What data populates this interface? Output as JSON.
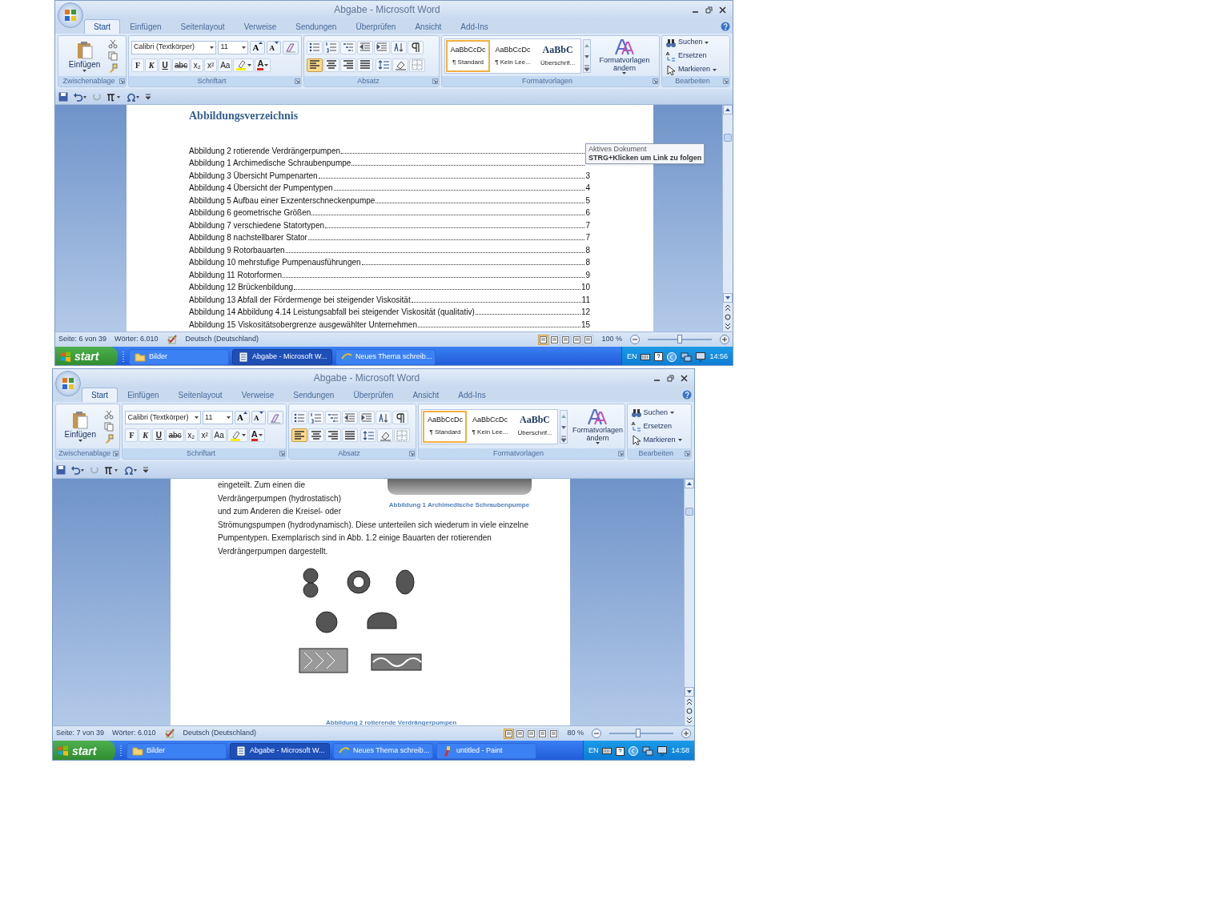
{
  "windows": [
    {
      "title": "Abgabe - Microsoft Word",
      "tabs": [
        {
          "label": "Start",
          "selected": true
        },
        {
          "label": "Einfügen",
          "selected": false
        },
        {
          "label": "Seitenlayout",
          "selected": false
        },
        {
          "label": "Verweise",
          "selected": false
        },
        {
          "label": "Sendungen",
          "selected": false
        },
        {
          "label": "Überprüfen",
          "selected": false
        },
        {
          "label": "Ansicht",
          "selected": false
        },
        {
          "label": "Add-Ins",
          "selected": false
        }
      ],
      "ribbon": {
        "clipboard": {
          "paste": "Einfügen",
          "label": "Zwischenablage"
        },
        "font": {
          "name": "Calibri (Textkörper)",
          "size": "11",
          "size_buttons": [
            "A",
            "A"
          ],
          "format_buttons": [
            "F",
            "K",
            "U",
            "abc",
            "x₂",
            "x²",
            "Aa"
          ],
          "color_button": "A",
          "label": "Schriftart"
        },
        "paragraph": {
          "alignment_buttons": [
            {
              "selected": true
            },
            {
              "selected": false
            },
            {
              "selected": false
            },
            {
              "selected": false
            }
          ],
          "label": "Absatz"
        },
        "styles": {
          "items": [
            {
              "sample": "AaBbCcDc",
              "name": "¶ Standard",
              "selected": true,
              "kind": "normal"
            },
            {
              "sample": "AaBbCcDc",
              "name": "¶ Kein Lee...",
              "selected": false,
              "kind": "normal"
            },
            {
              "sample": "AaBbC",
              "name": "Überschrif...",
              "selected": false,
              "kind": "heading"
            }
          ],
          "change_button": "Formatvorlagen ändern",
          "label": "Formatvorlagen"
        },
        "editing": {
          "buttons": [
            "Suchen",
            "Ersetzen",
            "Markieren"
          ],
          "label": "Bearbeiten"
        }
      },
      "document": {
        "kind": "toc",
        "heading": "Abbildungsverzeichnis",
        "entries": [
          {
            "text": "Abbildung 2 rotierende Verdrängerpumpen"
          },
          {
            "text": "Abbildung 1 Archimedische Schraubenpumpe"
          },
          {
            "text": "Abbildung 3 Übersicht Pumpenarten",
            "page": "3"
          },
          {
            "text": "Abbildung 4 Übersicht der Pumpentypen",
            "page": "4"
          },
          {
            "text": "Abbildung 5 Aufbau einer Exzenterschneckenpumpe",
            "page": "5"
          },
          {
            "text": "Abbildung 6 geometrische Größen",
            "page": "6"
          },
          {
            "text": "Abbildung 7 verschiedene Statortypen",
            "page": "7"
          },
          {
            "text": "Abbildung 8 nachstellbarer Stator",
            "page": "7"
          },
          {
            "text": "Abbildung 9 Rotorbauarten",
            "page": "8"
          },
          {
            "text": "Abbildung 10 mehrstufige Pumpenausführungen",
            "page": "8"
          },
          {
            "text": "Abbildung 11 Rotorformen",
            "page": "9"
          },
          {
            "text": "Abbildung 12 Brückenbildung",
            "page": "10"
          },
          {
            "text": "Abbildung 13 Abfall der Fördermenge bei steigender Viskosität",
            "page": "11"
          },
          {
            "text": "Abbildung 14 Abbildung 4.14 Leistungsabfall bei steigender Viskosität (qualitativ)",
            "page": "12"
          },
          {
            "text": "Abbildung 15 Viskositätsobergrenze ausgewählter Unternehmen",
            "page": "15"
          }
        ],
        "tooltip": {
          "title": "Aktives Dokument",
          "hint": "STRG+Klicken um Link zu folgen"
        }
      },
      "status_bar": {
        "page": "Seite: 6 von 39",
        "words": "Wörter: 6.010",
        "language": "Deutsch (Deutschland)",
        "views": [
          {
            "selected": true
          },
          {
            "selected": false
          },
          {
            "selected": false
          },
          {
            "selected": false
          },
          {
            "selected": false
          }
        ],
        "zoom": "100 %",
        "zoom_slider": {
          "level": 0.5
        }
      },
      "taskbar": {
        "start": "start",
        "items": [
          {
            "label": "Bilder",
            "kind": "folder",
            "selected": false
          },
          {
            "label": "Abgabe - Microsoft W...",
            "kind": "word",
            "selected": true
          },
          {
            "label": "Neues Thema schreib...",
            "kind": "browser",
            "selected": false
          }
        ],
        "language": "EN",
        "clock": "14:56"
      }
    },
    {
      "title": "Abgabe - Microsoft Word",
      "tabs": [
        {
          "label": "Start",
          "selected": true
        },
        {
          "label": "Einfügen",
          "selected": false
        },
        {
          "label": "Seitenlayout",
          "selected": false
        },
        {
          "label": "Verweise",
          "selected": false
        },
        {
          "label": "Sendungen",
          "selected": false
        },
        {
          "label": "Überprüfen",
          "selected": false
        },
        {
          "label": "Ansicht",
          "selected": false
        },
        {
          "label": "Add-Ins",
          "selected": false
        }
      ],
      "ribbon": {
        "clipboard": {
          "paste": "Einfügen",
          "label": "Zwischenablage"
        },
        "font": {
          "name": "Calibri (Textkörper)",
          "size": "11",
          "size_buttons": [
            "A",
            "A"
          ],
          "format_buttons": [
            "F",
            "K",
            "U",
            "abc",
            "x₂",
            "x²",
            "Aa"
          ],
          "color_button": "A",
          "label": "Schriftart"
        },
        "paragraph": {
          "alignment_buttons": [
            {
              "selected": true
            },
            {
              "selected": false
            },
            {
              "selected": false
            },
            {
              "selected": false
            }
          ],
          "label": "Absatz"
        },
        "styles": {
          "items": [
            {
              "sample": "AaBbCcDc",
              "name": "¶ Standard",
              "selected": true,
              "kind": "normal"
            },
            {
              "sample": "AaBbCcDc",
              "name": "¶ Kein Lee...",
              "selected": false,
              "kind": "normal"
            },
            {
              "sample": "AaBbC",
              "name": "Überschrif...",
              "selected": false,
              "kind": "heading"
            }
          ],
          "change_button": "Formatvorlagen ändern",
          "label": "Formatvorlagen"
        },
        "editing": {
          "buttons": [
            "Suchen",
            "Ersetzen",
            "Markieren"
          ],
          "label": "Bearbeiten"
        }
      },
      "document": {
        "kind": "body",
        "wrap_lines": [
          "eingeteilt. Zum einen die",
          "Verdrängerpumpen (hydrostatisch)",
          "und zum Anderen die Kreisel- oder"
        ],
        "side_caption": "Abbildung 1 Archimedische Schraubenpumpe",
        "lines": [
          "Strömungspumpen (hydrodynamisch). Diese unterteilen sich wiederum in viele einzelne",
          "Pumpentypen. Exemplarisch sind in Abb. 1.2 einige Bauarten der rotierenden",
          "Verdrängerpumpen dargestellt."
        ],
        "figure_caption": "Abbildung 2 rotierende Verdrängerpumpen"
      },
      "status_bar": {
        "page": "Seite: 7 von 39",
        "words": "Wörter: 6.010",
        "language": "Deutsch (Deutschland)",
        "views": [
          {
            "selected": true
          },
          {
            "selected": false
          },
          {
            "selected": false
          },
          {
            "selected": false
          },
          {
            "selected": false
          }
        ],
        "zoom": "80 %",
        "zoom_slider": {
          "level": 0.45
        }
      },
      "taskbar": {
        "start": "start",
        "items": [
          {
            "label": "Bilder",
            "kind": "folder",
            "selected": false
          },
          {
            "label": "Abgabe - Microsoft W...",
            "kind": "word",
            "selected": true
          },
          {
            "label": "Neues Thema schreib...",
            "kind": "browser",
            "selected": false
          },
          {
            "label": "untitled - Paint",
            "kind": "paint",
            "selected": false
          }
        ],
        "language": "EN",
        "clock": "14:58"
      }
    }
  ]
}
